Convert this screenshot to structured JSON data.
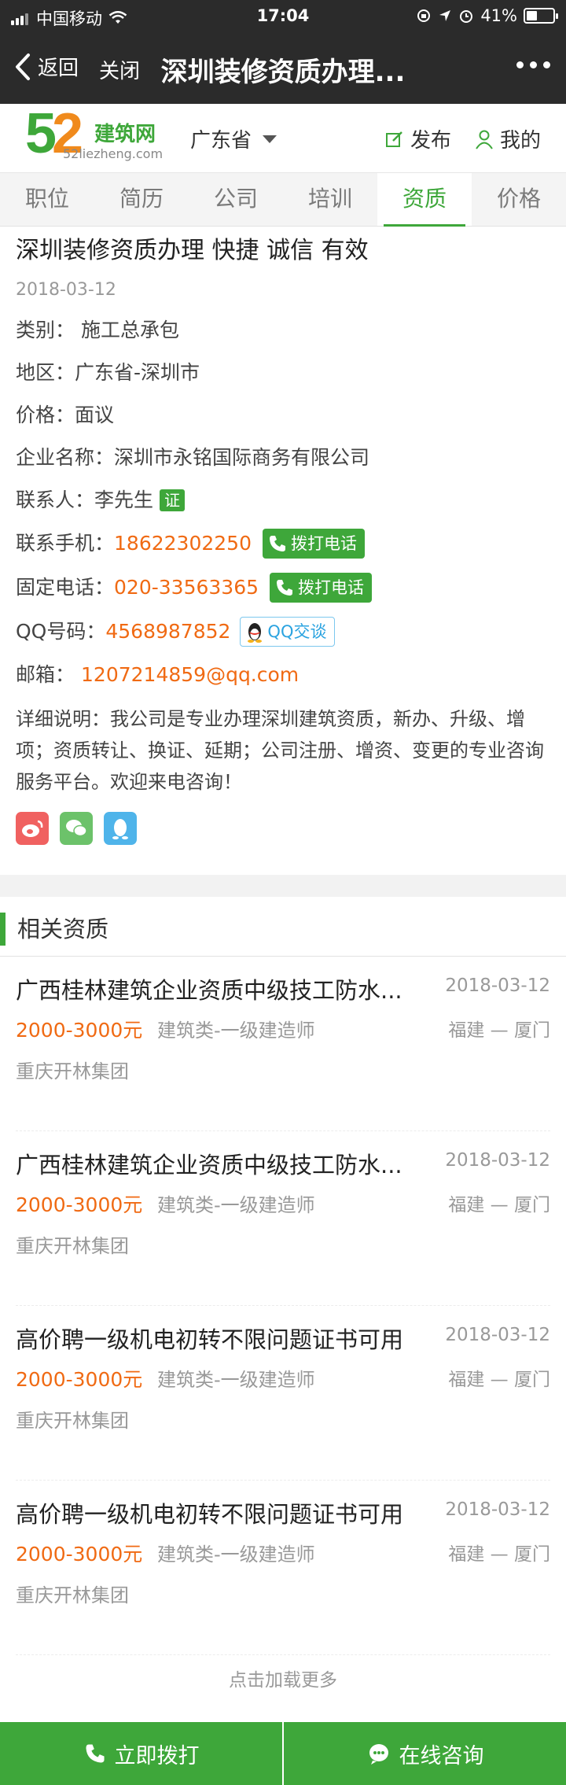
{
  "status": {
    "carrier": "中国移动",
    "time": "17:04",
    "battery": "41%",
    "battery_level": 0.41
  },
  "nav": {
    "back": "返回",
    "close": "关闭",
    "title": "深圳装修资质办理..."
  },
  "header": {
    "logo_brand": "建筑网",
    "logo_url": "52liezheng.com",
    "province": "广东省",
    "publish": "发布",
    "mine": "我的"
  },
  "tabs": [
    {
      "label": "职位",
      "active": false
    },
    {
      "label": "简历",
      "active": false
    },
    {
      "label": "公司",
      "active": false
    },
    {
      "label": "培训",
      "active": false
    },
    {
      "label": "资质",
      "active": true
    },
    {
      "label": "价格",
      "active": false
    }
  ],
  "detail": {
    "title": "深圳装修资质办理  快捷  诚信  有效",
    "date": "2018-03-12",
    "category_label": "类别：",
    "category": "施工总承包",
    "region_label": "地区：",
    "region": "广东省-深圳市",
    "price_label": "价格：",
    "price": "面议",
    "company_label": "企业名称：",
    "company": "深圳市永铭国际商务有限公司",
    "contact_label": "联系人：",
    "contact": "李先生",
    "cert": "证",
    "mobile_label": "联系手机：",
    "mobile": "18622302250",
    "phone_label": "固定电话：",
    "phone": "020-33563365",
    "call_label": "拨打电话",
    "qq_label": "QQ号码：",
    "qq": "4568987852",
    "qq_chat": "QQ交谈",
    "email_label": "邮箱：",
    "email": "1207214859@qq.com",
    "description": "详细说明：我公司是专业办理深圳建筑资质，新办、升级、增项；资质转让、换证、延期；公司注册、增资、变更的专业咨询服务平台。欢迎来电咨询！"
  },
  "related": {
    "heading": "相关资质",
    "items": [
      {
        "title": "广西桂林建筑企业资质中级技工防水...",
        "date": "2018-03-12",
        "price": "2000-3000元",
        "category": "建筑类-一级建造师",
        "location": "福建 — 厦门",
        "company": "重庆开林集团"
      },
      {
        "title": "广西桂林建筑企业资质中级技工防水...",
        "date": "2018-03-12",
        "price": "2000-3000元",
        "category": "建筑类-一级建造师",
        "location": "福建 — 厦门",
        "company": "重庆开林集团"
      },
      {
        "title": "高价聘一级机电初转不限问题证书可用",
        "date": "2018-03-12",
        "price": "2000-3000元",
        "category": "建筑类-一级建造师",
        "location": "福建 — 厦门",
        "company": "重庆开林集团"
      },
      {
        "title": "高价聘一级机电初转不限问题证书可用",
        "date": "2018-03-12",
        "price": "2000-3000元",
        "category": "建筑类-一级建造师",
        "location": "福建 — 厦门",
        "company": "重庆开林集团"
      }
    ],
    "load_more": "点击加载更多"
  },
  "bottom": {
    "call": "立即拨打",
    "consult": "在线咨询"
  },
  "colors": {
    "brand_green": "#3ea73a",
    "accent_orange": "#f06a13",
    "nav_dark": "#2b2b2b"
  }
}
